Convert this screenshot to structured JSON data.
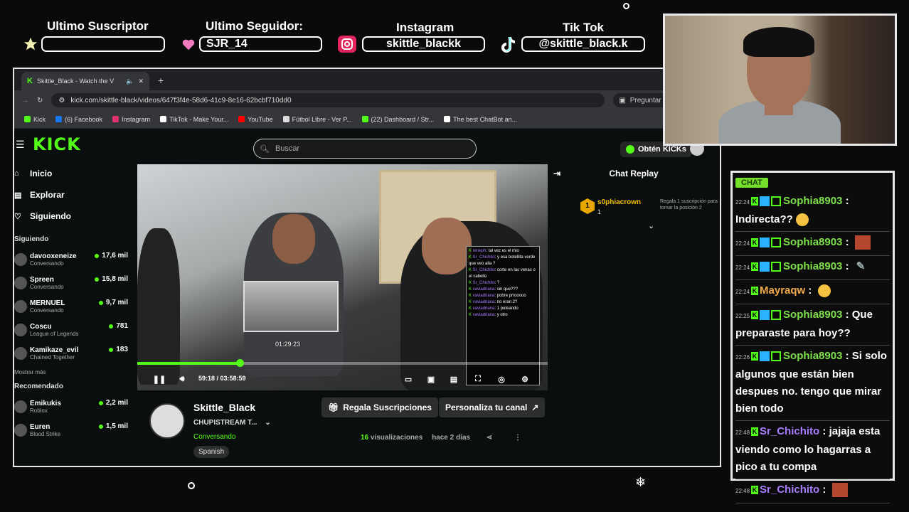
{
  "overlay": {
    "labels": {
      "subscriber": "Ultimo Suscriptor",
      "follower": "Ultimo Seguidor:",
      "instagram": "Instagram",
      "tiktok": "Tik Tok"
    },
    "values": {
      "subscriber": "",
      "follower": "SJR_14",
      "instagram": "skittle_blackk",
      "tiktok": "@skittle_black.k"
    },
    "icons": [
      "star-icon",
      "heart-icon",
      "instagram-icon",
      "tiktok-icon"
    ]
  },
  "browser": {
    "tab_title": "Skittle_Black - Watch the V",
    "url": "kick.com/skittle-black/videos/647f3f4e-58d6-41c9-8e16-62bcbf710dd0",
    "google_button": "Preguntar a Google",
    "bookmarks": [
      {
        "label": "Kick",
        "color": "#53fc18"
      },
      {
        "label": "(6) Facebook",
        "color": "#1877f2"
      },
      {
        "label": "Instagram",
        "color": "#e1306c"
      },
      {
        "label": "TikTok - Make Your...",
        "color": "#ffffff"
      },
      {
        "label": "YouTube",
        "color": "#ff0000"
      },
      {
        "label": "Fútbol Libre - Ver P...",
        "color": "#dddddd"
      },
      {
        "label": "(22) Dashboard / Str...",
        "color": "#53fc18"
      },
      {
        "label": "The best ChatBot an...",
        "color": "#ffffff"
      }
    ]
  },
  "kick": {
    "logo": "KICK",
    "search_placeholder": "Buscar",
    "get_kicks": "Obtén KICKs",
    "nav": [
      {
        "label": "Inicio",
        "icon": "home-icon"
      },
      {
        "label": "Explorar",
        "icon": "explore-icon"
      },
      {
        "label": "Siguiendo",
        "icon": "heart-icon"
      }
    ],
    "following_header": "Siguiendo",
    "following": [
      {
        "name": "davooxeneize",
        "sub": "Conversando",
        "viewers": "17,6 mil"
      },
      {
        "name": "Spreen",
        "sub": "Conversando",
        "viewers": "15,8 mil"
      },
      {
        "name": "MERNUEL",
        "sub": "Conversando",
        "viewers": "9,7 mil"
      },
      {
        "name": "Coscu",
        "sub": "League of Legends",
        "viewers": "781"
      },
      {
        "name": "Kamikaze_evil",
        "sub": "Chained Together",
        "viewers": "183"
      }
    ],
    "show_more": "Mostrar más",
    "recommended_header": "Recomendado",
    "recommended": [
      {
        "name": "Emikukis",
        "sub": "Roblox",
        "viewers": "2,2 mil"
      },
      {
        "name": "Euren",
        "sub": "Blood Strike",
        "viewers": "1,5 mil"
      }
    ],
    "player": {
      "hover_time": "01:29:23",
      "current_time": "59:18",
      "duration": "03:58:59",
      "time_display": "59:18 / 03:58:59",
      "progress_fraction": 0.25
    },
    "inner_chat": [
      {
        "user": "reneph",
        "text": ": tal vez es el mio"
      },
      {
        "user": "Sr_Chichito",
        "text": ": y esa botellita verde que veo alla ?"
      },
      {
        "user": "Sr_Chichito",
        "text": ": corte en las venas o el cabello"
      },
      {
        "user": "Sr_Chichito",
        "text": ": ?"
      },
      {
        "user": "vaviadriana",
        "text": ": sin que???"
      },
      {
        "user": "vaviadriana",
        "text": ": pobre prrooooo"
      },
      {
        "user": "vaviadriana",
        "text": ": no eran 2?"
      },
      {
        "user": "vaviadriana",
        "text": ": 1 puteando"
      },
      {
        "user": "vaviadriana",
        "text": ": y otro"
      }
    ],
    "channel": {
      "name": "Skittle_Black",
      "title": "CHUPISTREAM T...",
      "category": "Conversando",
      "tag": "Spanish",
      "gift_button": "Regala Suscripciones",
      "customize_button": "Personaliza tu canal",
      "views_count": "16",
      "views_label": "visualizaciones",
      "date": "hace 2 días"
    },
    "chat_replay": {
      "title": "Chat Replay",
      "gift_user": "s0phiacrown",
      "gift_rank": "1",
      "gift_count": "1",
      "gift_text": "Regala 1 suscripción para tomar la posición 2"
    }
  },
  "stream_chat": {
    "badge": "CHAT",
    "messages": [
      {
        "time": "22:24",
        "user": "Sophia8903",
        "color": "#7ee04b",
        "text": "Indirecta??",
        "emote": "emo"
      },
      {
        "time": "22:24",
        "user": "Sophia8903",
        "color": "#7ee04b",
        "text": "",
        "emote": "emo2"
      },
      {
        "time": "22:24",
        "user": "Sophia8903",
        "color": "#7ee04b",
        "text": "",
        "emote": "pin"
      },
      {
        "time": "22:24",
        "user": "Mayraqw",
        "color": "#f0a94a",
        "text": "",
        "emote": "emo"
      },
      {
        "time": "22:25",
        "user": "Sophia8903",
        "color": "#7ee04b",
        "text": "Que preparaste para hoy??",
        "emote": ""
      },
      {
        "time": "22:26",
        "user": "Sophia8903",
        "color": "#7ee04b",
        "text": "Si solo algunos que están bien despues no. tengo que mirar bien todo",
        "emote": ""
      },
      {
        "time": "22:48",
        "user": "Sr_Chichito",
        "color": "#a77dff",
        "text": "jajaja esta viendo como lo hagarras a pico a tu compa",
        "emote": ""
      },
      {
        "time": "22:48",
        "user": "Sr_Chichito",
        "color": "#a77dff",
        "text": "",
        "emote": "emo2"
      }
    ]
  }
}
